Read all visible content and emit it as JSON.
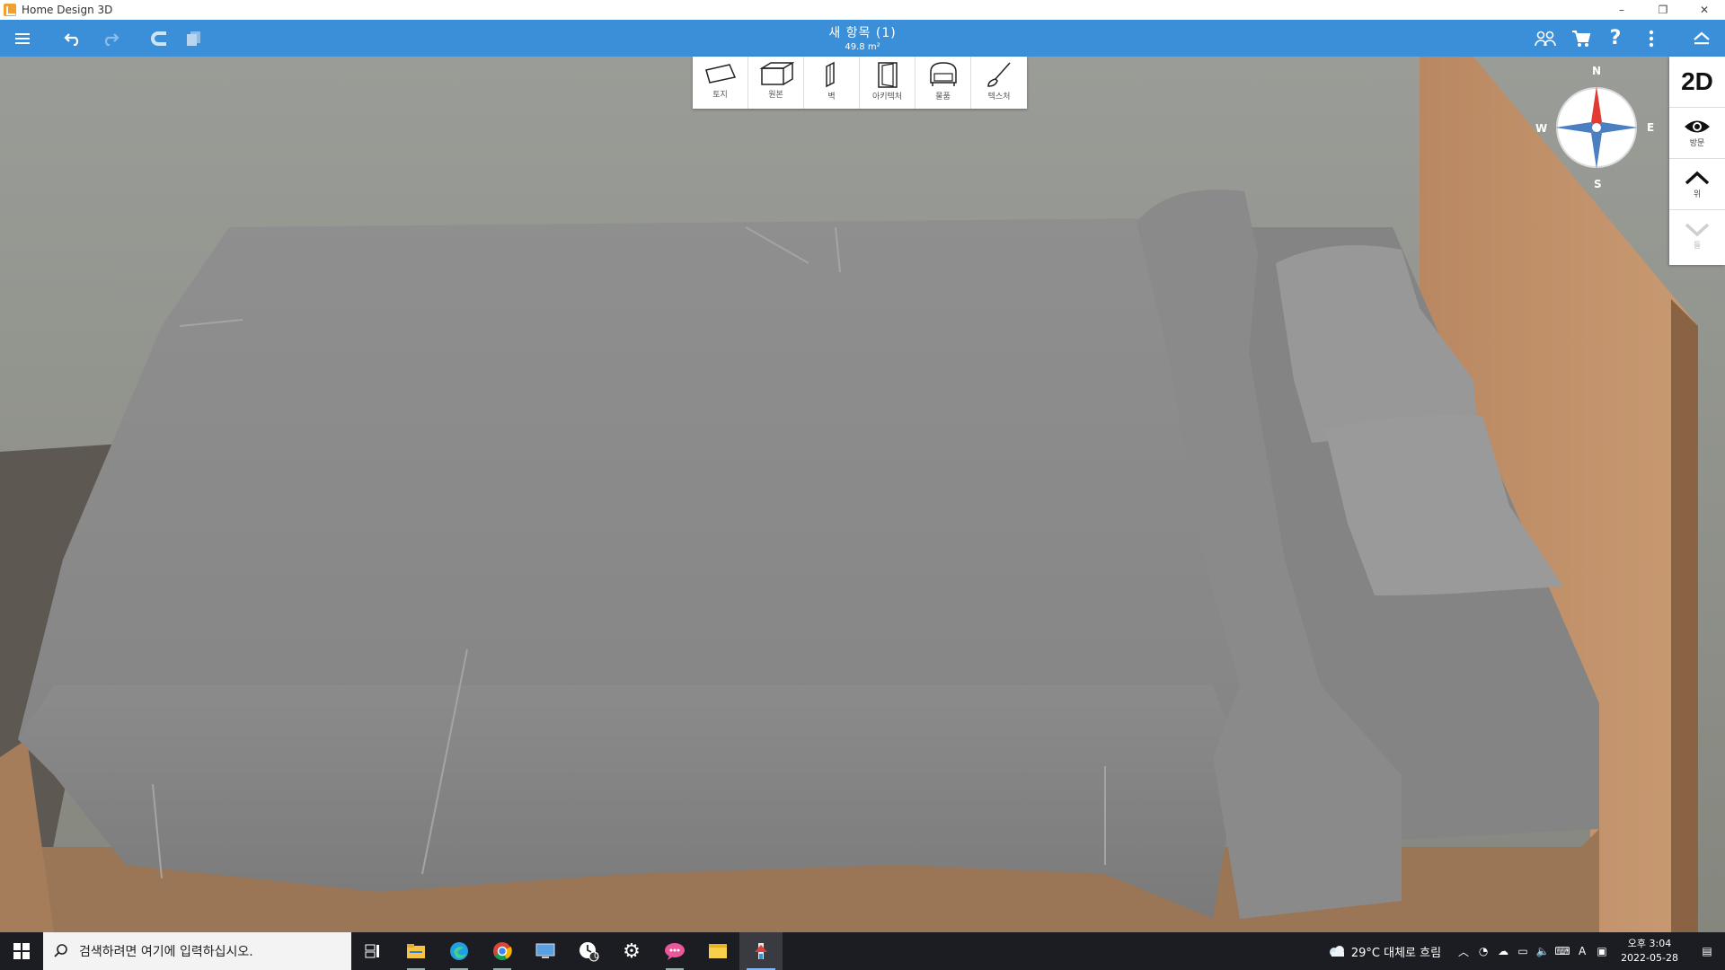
{
  "window": {
    "title": "Home Design 3D",
    "controls": [
      "–",
      "❐",
      "✕"
    ]
  },
  "toolbar": {
    "project_name": "새 항목 (1)",
    "project_area": "49.8 m²"
  },
  "palette": {
    "tools": [
      {
        "label": "토지",
        "icon": "floor-shape-icon"
      },
      {
        "label": "원본",
        "icon": "room-box-icon"
      },
      {
        "label": "벽",
        "icon": "wall-icon"
      },
      {
        "label": "아키텍처",
        "icon": "door-icon"
      },
      {
        "label": "물품",
        "icon": "armchair-icon"
      },
      {
        "label": "텍스처",
        "icon": "paintbrush-icon"
      }
    ]
  },
  "compass": {
    "n": "N",
    "s": "S",
    "e": "E",
    "w": "W"
  },
  "right_panel": {
    "mode_2d": "2D",
    "visit_label": "방문",
    "up_label": "위",
    "down_label": "들"
  },
  "taskbar": {
    "search_placeholder": "검색하려면 여기에 입력하십시오.",
    "weather": "29°C  대체로 흐림",
    "time": "오후 3:04",
    "date": "2022-05-28",
    "lang": "A",
    "badge_count": "0"
  },
  "colors": {
    "toolbar_blue": "#3a8fd8",
    "taskbar": "#1c1d22",
    "wall": "#8f918c",
    "bedding": "#8e8e8e",
    "wood": "#b98963"
  }
}
